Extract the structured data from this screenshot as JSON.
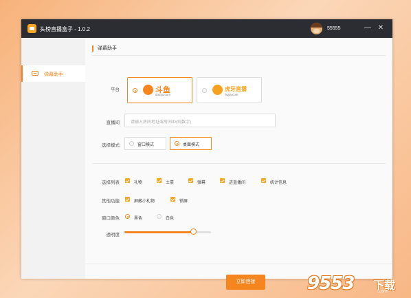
{
  "titlebar": {
    "title": "头榜直播盒子 - 1.0.2",
    "username": "55555",
    "minimize": "—",
    "close": "✕"
  },
  "sidebar": {
    "items": [
      {
        "label": "弹幕助手"
      }
    ]
  },
  "main": {
    "section_title": "弹幕助手",
    "platform": {
      "label": "平台",
      "options": [
        {
          "name": "斗鱼",
          "sub": "douyu.com",
          "selected": true
        },
        {
          "name": "虎牙直播",
          "sub": "huya.com",
          "selected": false
        }
      ]
    },
    "room": {
      "label": "直播间",
      "placeholder": "请输入房间地址或房间ID(纯数字)"
    },
    "mode": {
      "label": "选择模式",
      "options": [
        {
          "label": "窗口模式",
          "selected": false
        },
        {
          "label": "桌面模式",
          "selected": true
        }
      ]
    },
    "list": {
      "label": "选择列表",
      "options": [
        {
          "label": "礼物",
          "checked": true
        },
        {
          "label": "土豪",
          "checked": true
        },
        {
          "label": "弹幕",
          "checked": true
        },
        {
          "label": "进直播间",
          "checked": true
        },
        {
          "label": "统计信息",
          "checked": true
        }
      ]
    },
    "other": {
      "label": "其他功能",
      "options": [
        {
          "label": "屏蔽小礼物",
          "checked": true
        },
        {
          "label": "锁屏",
          "checked": true
        }
      ]
    },
    "color": {
      "label": "窗口颜色",
      "options": [
        {
          "label": "黑色",
          "selected": true
        },
        {
          "label": "白色",
          "selected": false
        }
      ]
    },
    "opacity": {
      "label": "透明度",
      "value": 0.8
    },
    "connect_button": "立即连接"
  },
  "watermark": {
    "text": "9553",
    "suffix": "下载",
    "domain": ".com"
  },
  "colors": {
    "accent": "#f5861f",
    "titlebar": "#2b2d33",
    "sidebar": "#f2f2f2"
  }
}
